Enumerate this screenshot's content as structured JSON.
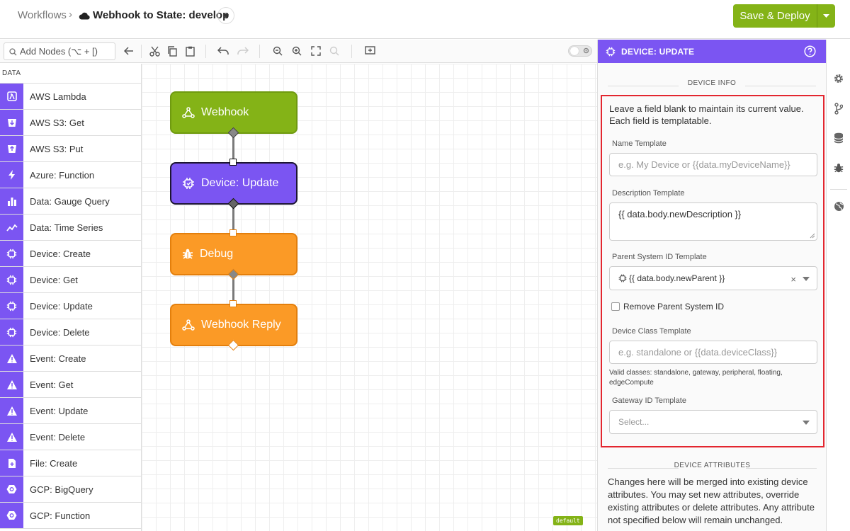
{
  "header": {
    "breadcrumb": "Workflows",
    "separator": "›",
    "workflow_title": "Webhook to State: develop",
    "deploy_label": "Save & Deploy"
  },
  "toolbar": {
    "search_placeholder": "Add Nodes (⌥ + [)"
  },
  "palette": {
    "section": "DATA",
    "items": [
      {
        "label": "AWS Lambda",
        "icon": "lambda-icon"
      },
      {
        "label": "AWS S3: Get",
        "icon": "bucket-get-icon"
      },
      {
        "label": "AWS S3: Put",
        "icon": "bucket-put-icon"
      },
      {
        "label": "Azure: Function",
        "icon": "bolt-icon"
      },
      {
        "label": "Data: Gauge Query",
        "icon": "bar-chart-icon"
      },
      {
        "label": "Data: Time Series",
        "icon": "line-chart-icon"
      },
      {
        "label": "Device: Create",
        "icon": "device-icon"
      },
      {
        "label": "Device: Get",
        "icon": "device-icon"
      },
      {
        "label": "Device: Update",
        "icon": "device-icon"
      },
      {
        "label": "Device: Delete",
        "icon": "device-icon"
      },
      {
        "label": "Event: Create",
        "icon": "event-icon"
      },
      {
        "label": "Event: Get",
        "icon": "event-icon"
      },
      {
        "label": "Event: Update",
        "icon": "event-icon"
      },
      {
        "label": "Event: Delete",
        "icon": "event-icon"
      },
      {
        "label": "File: Create",
        "icon": "file-icon"
      },
      {
        "label": "GCP: BigQuery",
        "icon": "gcp-icon"
      },
      {
        "label": "GCP: Function",
        "icon": "gcp-icon"
      }
    ]
  },
  "canvas": {
    "nodes": [
      {
        "label": "Webhook",
        "color": "#84b317"
      },
      {
        "label": "Device: Update",
        "color": "#7b55f2"
      },
      {
        "label": "Debug",
        "color": "#fb9a26"
      },
      {
        "label": "Webhook Reply",
        "color": "#fb9a26"
      }
    ],
    "default_tag": "default"
  },
  "panel": {
    "title": "DEVICE: UPDATE",
    "section_info": "DEVICE INFO",
    "intro": "Leave a field blank to maintain its current value. Each field is templatable.",
    "name_label": "Name Template",
    "name_placeholder": "e.g. My Device or {{data.myDeviceName}}",
    "description_label": "Description Template",
    "description_value": "{{ data.body.newDescription }}",
    "parent_label": "Parent System ID Template",
    "parent_value": "{{ data.body.newParent }}",
    "parent_clear": "×",
    "remove_parent_label": "Remove Parent System ID",
    "remove_parent_checked": false,
    "class_label": "Device Class Template",
    "class_placeholder": "e.g. standalone or {{data.deviceClass}}",
    "class_hint": "Valid classes: standalone, gateway, peripheral, floating, edgeCompute",
    "gateway_label": "Gateway ID Template",
    "gateway_placeholder": "Select...",
    "section_attributes": "DEVICE ATTRIBUTES",
    "attributes_text": "Changes here will be merged into existing device attributes. You may set new attributes, override existing attributes or delete attributes. Any attribute not specified below will remain unchanged."
  },
  "colors": {
    "accent_purple": "#7b55f2",
    "deploy_green": "#84b317",
    "debug_orange": "#fb9a26",
    "highlight_red": "#e3262f"
  }
}
